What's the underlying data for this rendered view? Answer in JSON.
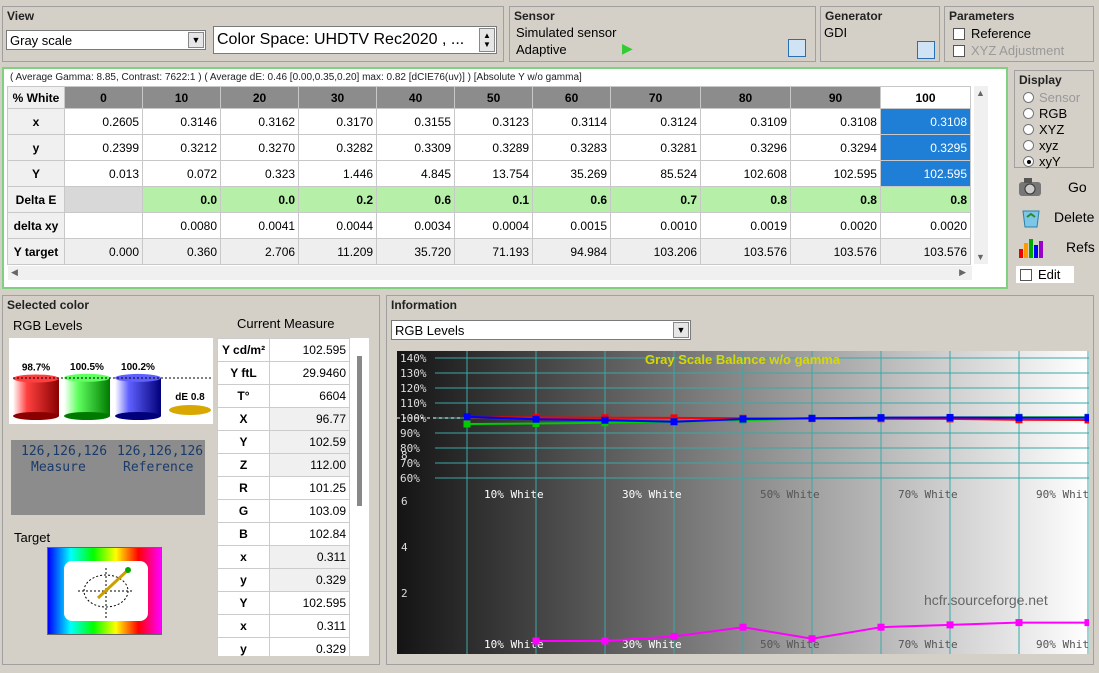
{
  "view": {
    "title": "View",
    "mode": "Gray scale",
    "colorspace": "Color Space: UHDTV Rec2020 , ..."
  },
  "sensor": {
    "title": "Sensor",
    "name": "Simulated sensor",
    "mode": "Adaptive"
  },
  "generator": {
    "title": "Generator",
    "name": "GDI"
  },
  "parameters": {
    "title": "Parameters",
    "reference": "Reference",
    "xyz_adjust": "XYZ Adjustment"
  },
  "summary": "( Average Gamma: 8.85, Contrast: 7622:1 ) ( Average dE: 0.46 [0.00,0.35,0.20] max: 0.82 [dCIE76(uv)] ) [Absolute Y w/o gamma]",
  "table": {
    "corner": "% White",
    "columns": [
      "0",
      "10",
      "20",
      "30",
      "40",
      "50",
      "60",
      "70",
      "80",
      "90",
      "100"
    ],
    "rows": [
      {
        "label": "x",
        "values": [
          "0.2605",
          "0.3146",
          "0.3162",
          "0.3170",
          "0.3155",
          "0.3123",
          "0.3114",
          "0.3124",
          "0.3109",
          "0.3108",
          "0.3108"
        ]
      },
      {
        "label": "y",
        "values": [
          "0.2399",
          "0.3212",
          "0.3270",
          "0.3282",
          "0.3309",
          "0.3289",
          "0.3283",
          "0.3281",
          "0.3296",
          "0.3294",
          "0.3295"
        ]
      },
      {
        "label": "Y",
        "values": [
          "0.013",
          "0.072",
          "0.323",
          "1.446",
          "4.845",
          "13.754",
          "35.269",
          "85.524",
          "102.608",
          "102.595",
          "102.595"
        ]
      },
      {
        "label": "Delta E",
        "values": [
          "",
          "0.0",
          "0.0",
          "0.2",
          "0.6",
          "0.1",
          "0.6",
          "0.7",
          "0.8",
          "0.8",
          "0.8"
        ]
      },
      {
        "label": "delta xy",
        "values": [
          "",
          "0.0080",
          "0.0041",
          "0.0044",
          "0.0034",
          "0.0004",
          "0.0015",
          "0.0010",
          "0.0019",
          "0.0020",
          "0.0020"
        ]
      },
      {
        "label": "Y target",
        "values": [
          "0.000",
          "0.360",
          "2.706",
          "11.209",
          "35.720",
          "71.193",
          "94.984",
          "103.206",
          "103.576",
          "103.576",
          "103.576"
        ]
      }
    ]
  },
  "display": {
    "title": "Display",
    "options": [
      "Sensor",
      "RGB",
      "XYZ",
      "xyz",
      "xyY"
    ],
    "selected": "xyY"
  },
  "actions": {
    "go": "Go",
    "delete": "Delete",
    "refs": "Refs",
    "edit": "Edit"
  },
  "selected_color": {
    "title": "Selected color",
    "rgb_levels": "RGB Levels",
    "r_pct": "98.7%",
    "g_pct": "100.5%",
    "b_pct": "100.2%",
    "de": "dE 0.8",
    "r_level": 0.987,
    "g_level": 1.005,
    "b_level": 1.002,
    "measure_val": "126,126,126",
    "measure_lbl": "Measure",
    "reference_val": "126,126,126",
    "reference_lbl": "Reference",
    "target": "Target"
  },
  "current_measure": {
    "title": "Current Measure",
    "rows": [
      {
        "label": "Y cd/m²",
        "value": "102.595"
      },
      {
        "label": "Y ftL",
        "value": "29.9460"
      },
      {
        "label": "T°",
        "value": "6604"
      },
      {
        "label": "X",
        "value": "96.77"
      },
      {
        "label": "Y",
        "value": "102.59"
      },
      {
        "label": "Z",
        "value": "112.00"
      },
      {
        "label": "R",
        "value": "101.25"
      },
      {
        "label": "G",
        "value": "103.09"
      },
      {
        "label": "B",
        "value": "102.84"
      },
      {
        "label": "x",
        "value": "0.311"
      },
      {
        "label": "y",
        "value": "0.329"
      },
      {
        "label": "Y",
        "value": "102.595"
      },
      {
        "label": "x",
        "value": "0.311"
      },
      {
        "label": "y",
        "value": "0.329"
      }
    ]
  },
  "information": {
    "title": "Information",
    "dropdown": "RGB Levels",
    "chart_title": "Gray Scale Balance w/o gamma",
    "watermark": "hcfr.sourceforge.net"
  },
  "chart_data": {
    "type": "line",
    "title": "Gray Scale Balance w/o gamma",
    "x_labels": [
      "10% White",
      "30% White",
      "50% White",
      "70% White",
      "90% White"
    ],
    "y_ticks": [
      "140%",
      "130%",
      "120%",
      "110%",
      "100%",
      "90%",
      "80%",
      "70%",
      "60%"
    ],
    "de_ticks": [
      "8",
      "6",
      "4",
      "2"
    ],
    "x": [
      0,
      10,
      20,
      30,
      40,
      50,
      60,
      70,
      80,
      90,
      100
    ],
    "series": [
      {
        "color": "#ff0000",
        "values": [
          100.5,
          100.3,
          100.2,
          100.1,
          99.8,
          99.6,
          99.5,
          99.4,
          98.8,
          98.7,
          98.7
        ]
      },
      {
        "color": "#00cc00",
        "values": [
          96,
          96.3,
          96.8,
          97.5,
          98.5,
          99.8,
          100.2,
          100.4,
          100.5,
          100.5,
          100.5
        ]
      },
      {
        "color": "#0000ff",
        "values": [
          100.8,
          99.2,
          98.5,
          97.5,
          99.3,
          99.8,
          100.2,
          100.3,
          100.2,
          100.2,
          100.2
        ]
      }
    ],
    "de_series": {
      "color": "#ff00ff",
      "values": [
        0.0,
        0.0,
        0.2,
        0.6,
        0.1,
        0.6,
        0.7,
        0.8,
        0.8,
        0.8
      ]
    }
  }
}
